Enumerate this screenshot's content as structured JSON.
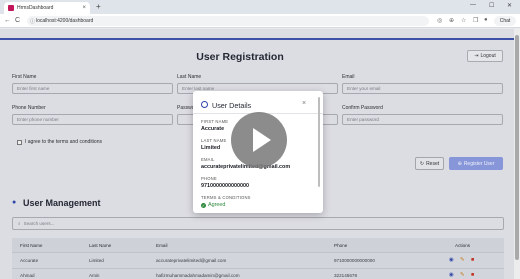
{
  "browser": {
    "tab_title": "HrmsDashboard",
    "url": "localhost:4200/dashboard",
    "chat_label": "Chat",
    "new_tab": "+",
    "tab_close": "×",
    "back": "←",
    "reload": "C",
    "minimize": "—",
    "maximize": "☐",
    "close": "✕"
  },
  "header": {
    "title": "User Registration",
    "logout_label": "Logout"
  },
  "form": {
    "first_name": {
      "label": "First Name",
      "placeholder": "Enter first name"
    },
    "last_name": {
      "label": "Last Name",
      "placeholder": "Enter last name"
    },
    "email": {
      "label": "Email",
      "placeholder": "Enter your email"
    },
    "phone": {
      "label": "Phone Number",
      "placeholder": "Enter phone number"
    },
    "password": {
      "label": "Password",
      "placeholder": ""
    },
    "confirm_password": {
      "label": "Confirm Password",
      "placeholder": "Enter password"
    },
    "terms_label": "I agree to the terms and conditions",
    "reset_label": "Reset",
    "register_label": "Register User"
  },
  "management": {
    "title": "User Management",
    "search_placeholder": "Search users...",
    "columns": [
      "First Name",
      "Last Name",
      "Email",
      "Phone",
      "Actions"
    ],
    "rows": [
      [
        "Accurate",
        "Limited",
        "accurateprivatelimited@gmail.com",
        "9710000000000000"
      ],
      [
        "Ahmad",
        "Amin",
        "hafizmuhammadahmadamin@gmail.com",
        "322145678"
      ]
    ]
  },
  "modal": {
    "title": "User Details",
    "close": "×",
    "fields": [
      {
        "label": "FIRST NAME",
        "value": "Accurate"
      },
      {
        "label": "LAST NAME",
        "value": "Limited"
      },
      {
        "label": "EMAIL",
        "value": "accurateprivatelimited@gmail.com"
      },
      {
        "label": "PHONE",
        "value": "9710000000000000"
      },
      {
        "label": "TERMS & CONDITIONS",
        "value": "Agreed"
      }
    ]
  },
  "colors": {
    "accent": "#3d50a8",
    "register_btn": "#8796d8",
    "agreed": "#2e8b3e"
  }
}
